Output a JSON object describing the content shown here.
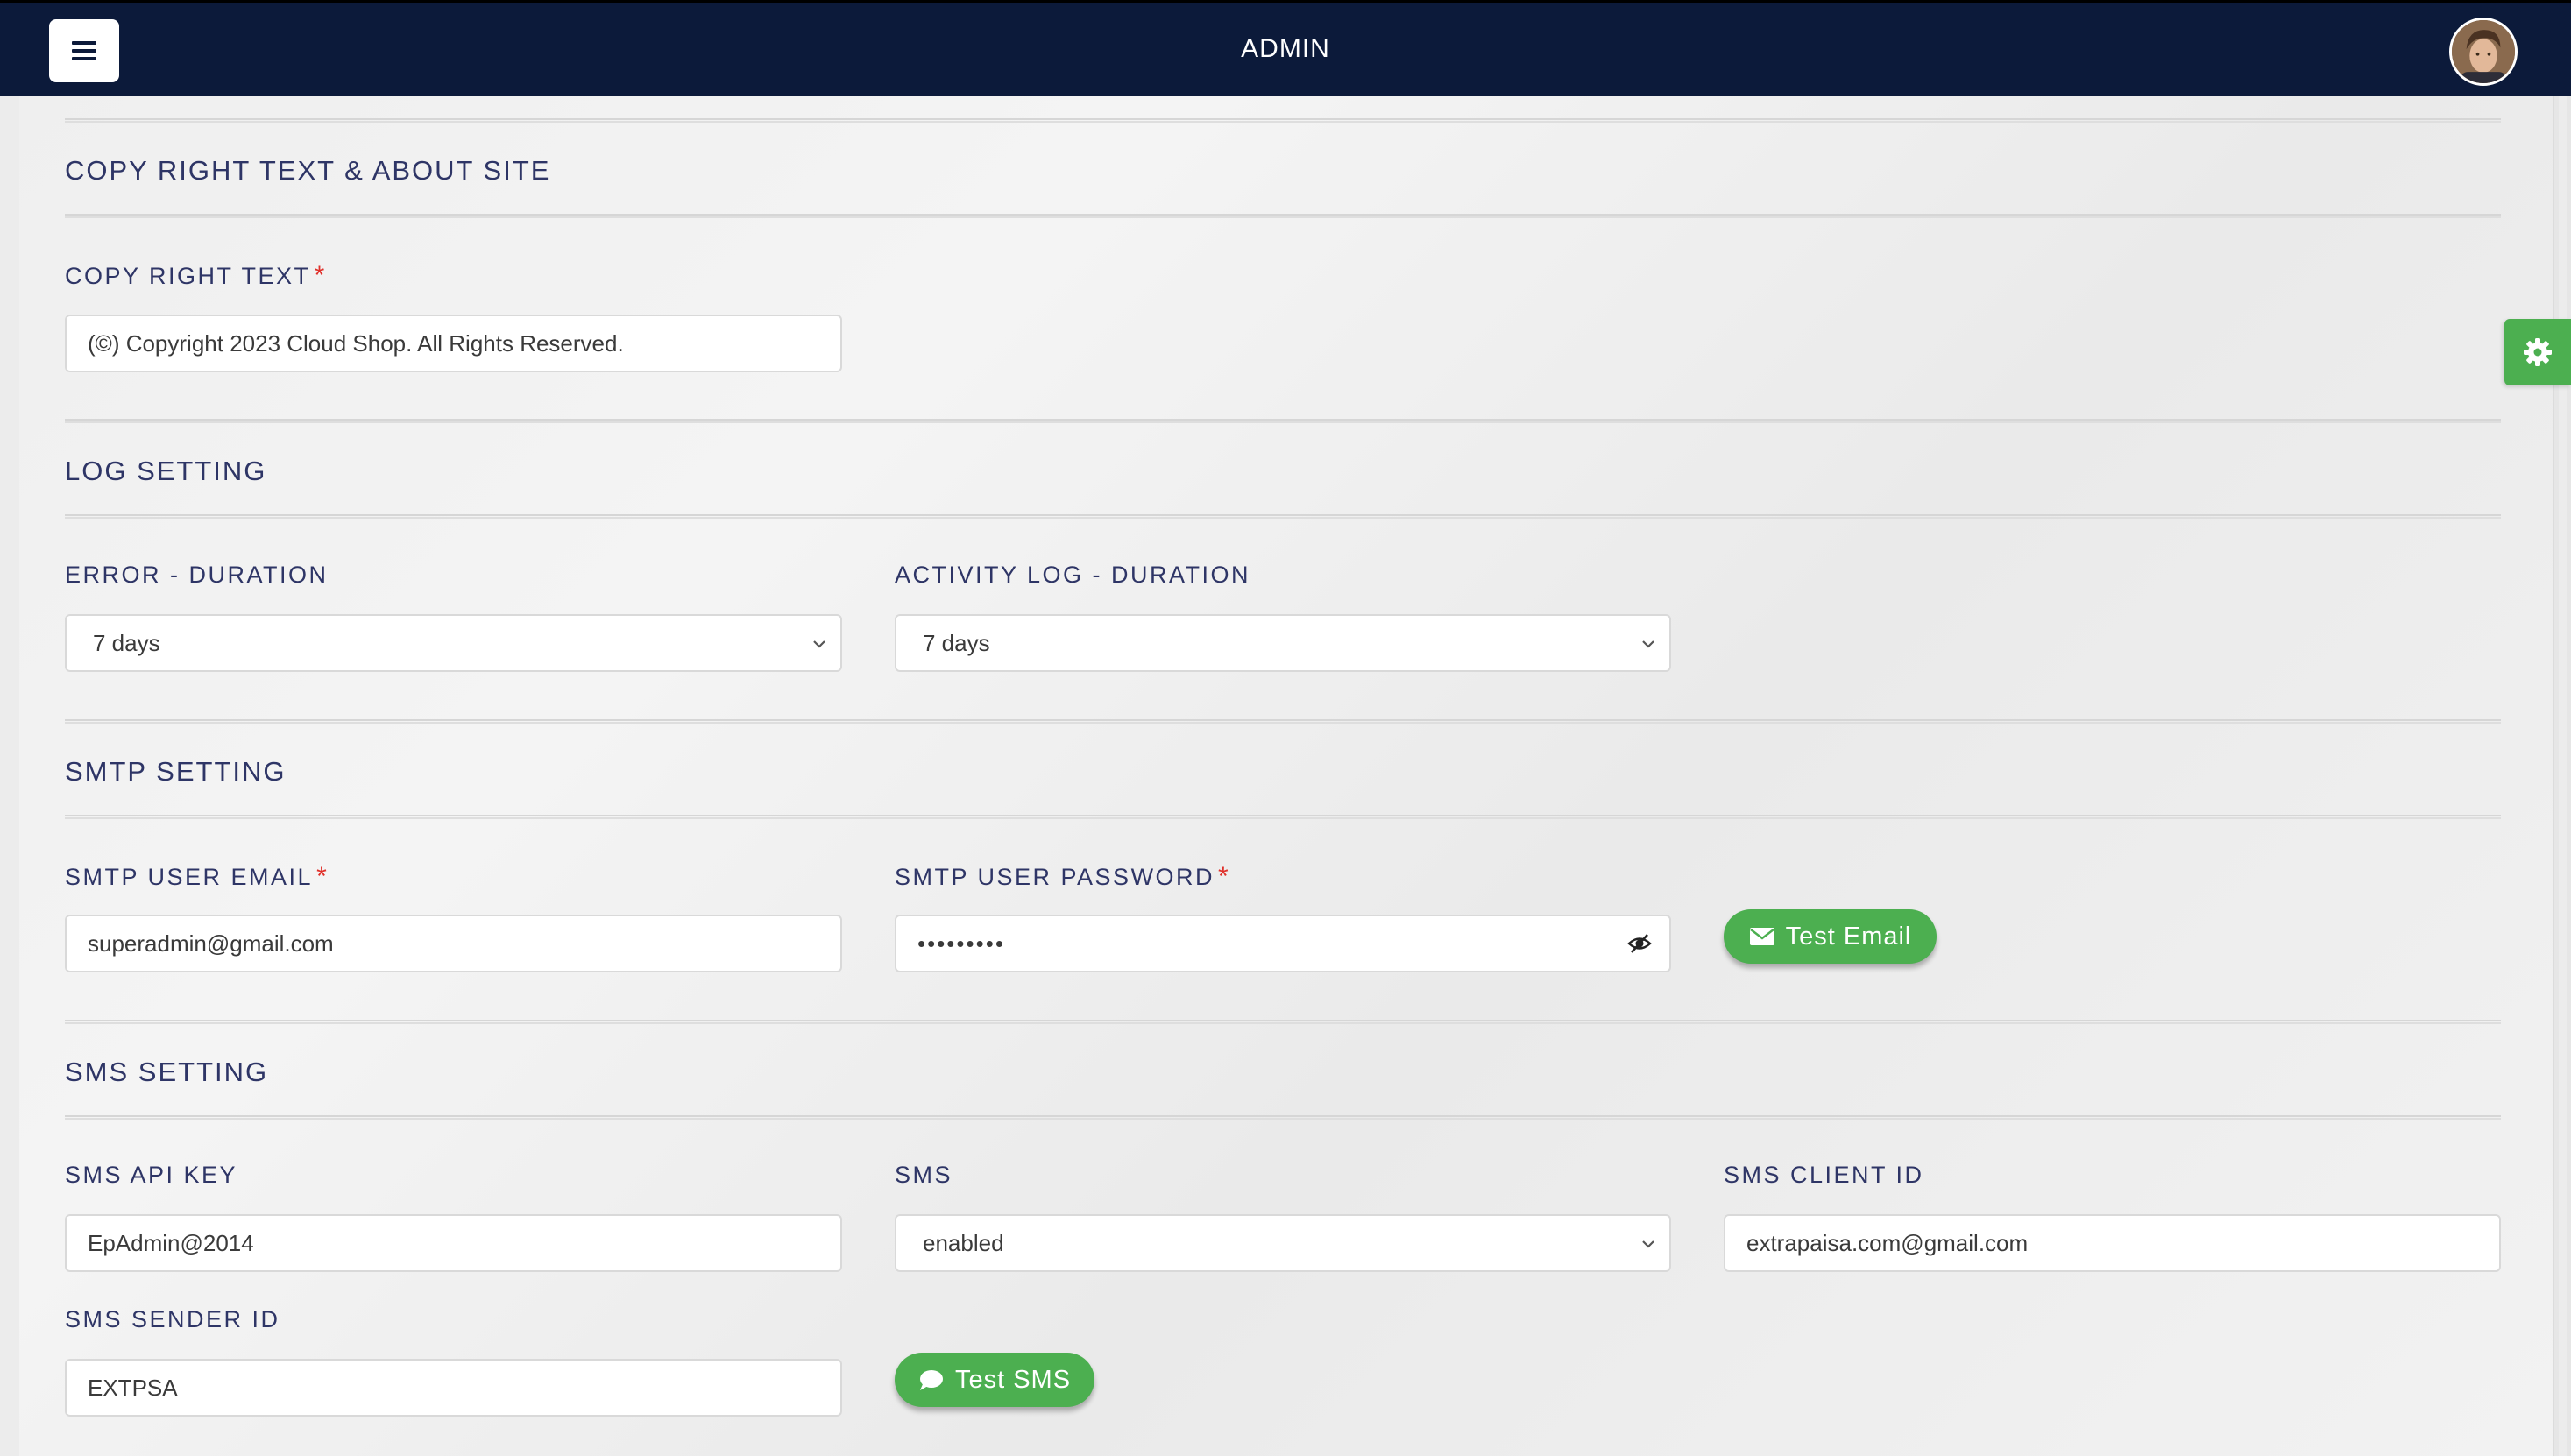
{
  "header": {
    "title": "ADMIN"
  },
  "sections": {
    "copyright": {
      "title": "COPY RIGHT TEXT & ABOUT SITE",
      "copyright_label": "COPY RIGHT TEXT",
      "copyright_value": "(©) Copyright 2023 Cloud Shop. All Rights Reserved."
    },
    "log": {
      "title": "LOG SETTING",
      "error_label": "ERROR - DURATION",
      "error_value": "7 days",
      "activity_label": "ACTIVITY LOG - DURATION",
      "activity_value": "7 days"
    },
    "smtp": {
      "title": "SMTP SETTING",
      "email_label": "SMTP USER EMAIL",
      "email_value": "superadmin@gmail.com",
      "password_label": "SMTP USER PASSWORD",
      "password_value": "password1",
      "test_button": "Test Email"
    },
    "sms": {
      "title": "SMS SETTING",
      "api_key_label": "SMS API KEY",
      "api_key_value": "EpAdmin@2014",
      "sms_label": "SMS",
      "sms_value": "enabled",
      "client_id_label": "SMS CLIENT ID",
      "client_id_value": "extrapaisa.com@gmail.com",
      "sender_id_label": "SMS SENDER ID",
      "sender_id_value": "EXTPSA",
      "test_button": "Test SMS"
    }
  },
  "required_marker": "*",
  "icons": {
    "menu": "hamburger-icon",
    "avatar": "user-avatar",
    "settings": "gear-icon",
    "email": "envelope-icon",
    "sms": "chat-bubble-icon",
    "password_toggle": "eye-slash-icon",
    "dropdown": "chevron-down-icon"
  },
  "colors": {
    "topbar": "#0c1a3a",
    "accent_green": "#4caf50",
    "label_text": "#2e3566",
    "required": "#e0302a"
  }
}
